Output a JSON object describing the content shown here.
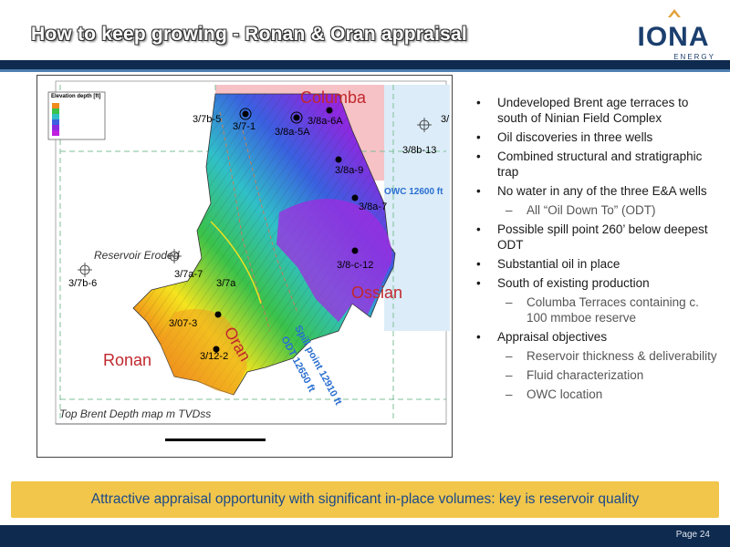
{
  "title": "How to keep growing  -  Ronan & Oran appraisal",
  "logo": {
    "name": "IONA",
    "sub": "ENERGY"
  },
  "map": {
    "fields": {
      "columba": "Columba",
      "ossian": "Ossian",
      "ronan": "Ronan",
      "oran": "Oran"
    },
    "wells": [
      "3/7b-5",
      "3/7-1",
      "3/8a-6A",
      "3/8a-5A",
      "3/8b-13",
      "3/8a-9",
      "3/8a-7",
      "3/8-c-12",
      "3/7a-7",
      "3/7a",
      "3/7b-6",
      "3/07-3",
      "3/12-2",
      "3/"
    ],
    "labels": {
      "owc": "OWC 12600 ft",
      "eroded": "Reservoir Eroded",
      "spill": "Spill point 12910 ft",
      "odt": "ODT 12650 ft",
      "caption": "Top Brent Depth map m TVDss",
      "legend_title": "Elevation depth [ft]"
    }
  },
  "bullets": [
    {
      "level": 1,
      "text": "Undeveloped Brent age terraces to south of Ninian Field Complex"
    },
    {
      "level": 1,
      "text": "Oil discoveries in three wells"
    },
    {
      "level": 1,
      "text": "Combined structural and stratigraphic trap"
    },
    {
      "level": 1,
      "text": "No water in any of the three E&A wells"
    },
    {
      "level": 2,
      "text": "All “Oil Down To” (ODT)"
    },
    {
      "level": 1,
      "text": "Possible spill point 260’ below deepest ODT"
    },
    {
      "level": 1,
      "text": "Substantial oil in place"
    },
    {
      "level": 1,
      "text": "South of existing production"
    },
    {
      "level": 2,
      "text": "Columba Terraces containing c. 100 mmboe reserve"
    },
    {
      "level": 1,
      "text": "Appraisal objectives"
    },
    {
      "level": 2,
      "text": "Reservoir thickness & deliverability"
    },
    {
      "level": 2,
      "text": "Fluid characterization"
    },
    {
      "level": 2,
      "text": "OWC location"
    }
  ],
  "banner": "Attractive appraisal opportunity with significant in-place volumes: key is reservoir quality",
  "page": "Page 24",
  "colors": {
    "navy": "#0e2a4e",
    "banner": "#f2c64b",
    "field_label": "#c0282d"
  }
}
